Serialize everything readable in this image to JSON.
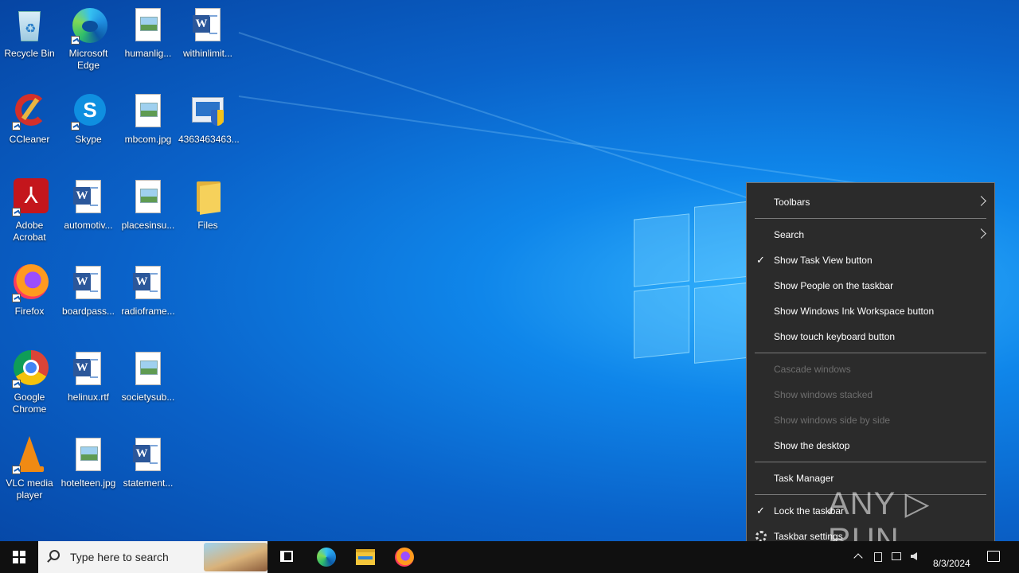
{
  "desktop": {
    "icons": [
      {
        "label": "Recycle Bin"
      },
      {
        "label": "Microsoft Edge"
      },
      {
        "label": "humanlig..."
      },
      {
        "label": "withinlimit..."
      },
      {
        "label": "CCleaner"
      },
      {
        "label": "Skype"
      },
      {
        "label": "mbcom.jpg"
      },
      {
        "label": "4363463463..."
      },
      {
        "label": "Adobe Acrobat"
      },
      {
        "label": "automotiv..."
      },
      {
        "label": "placesinsu..."
      },
      {
        "label": "Files"
      },
      {
        "label": "Firefox"
      },
      {
        "label": "boardpass..."
      },
      {
        "label": "radioframe..."
      },
      {
        "label": "Google Chrome"
      },
      {
        "label": "helinux.rtf"
      },
      {
        "label": "societysub..."
      },
      {
        "label": "VLC media player"
      },
      {
        "label": "hotelteen.jpg"
      },
      {
        "label": "statement..."
      }
    ]
  },
  "context_menu": {
    "toolbars": "Toolbars",
    "search": "Search",
    "show_task_view": "Show Task View button",
    "show_people": "Show People on the taskbar",
    "show_ink": "Show Windows Ink Workspace button",
    "show_touch_keyboard": "Show touch keyboard button",
    "cascade": "Cascade windows",
    "stacked": "Show windows stacked",
    "side_by_side": "Show windows side by side",
    "show_desktop": "Show the desktop",
    "task_manager": "Task Manager",
    "lock_taskbar": "Lock the taskbar",
    "taskbar_settings": "Taskbar settings",
    "check_glyph": "✓"
  },
  "watermark": {
    "text": "ANY ▷ RUN"
  },
  "taskbar": {
    "search_placeholder": "Type here to search",
    "date": "8/3/2024"
  },
  "colors": {
    "menu_bg": "#2b2b2b",
    "taskbar_bg": "#101010",
    "disabled_text": "#6e6e6e"
  }
}
